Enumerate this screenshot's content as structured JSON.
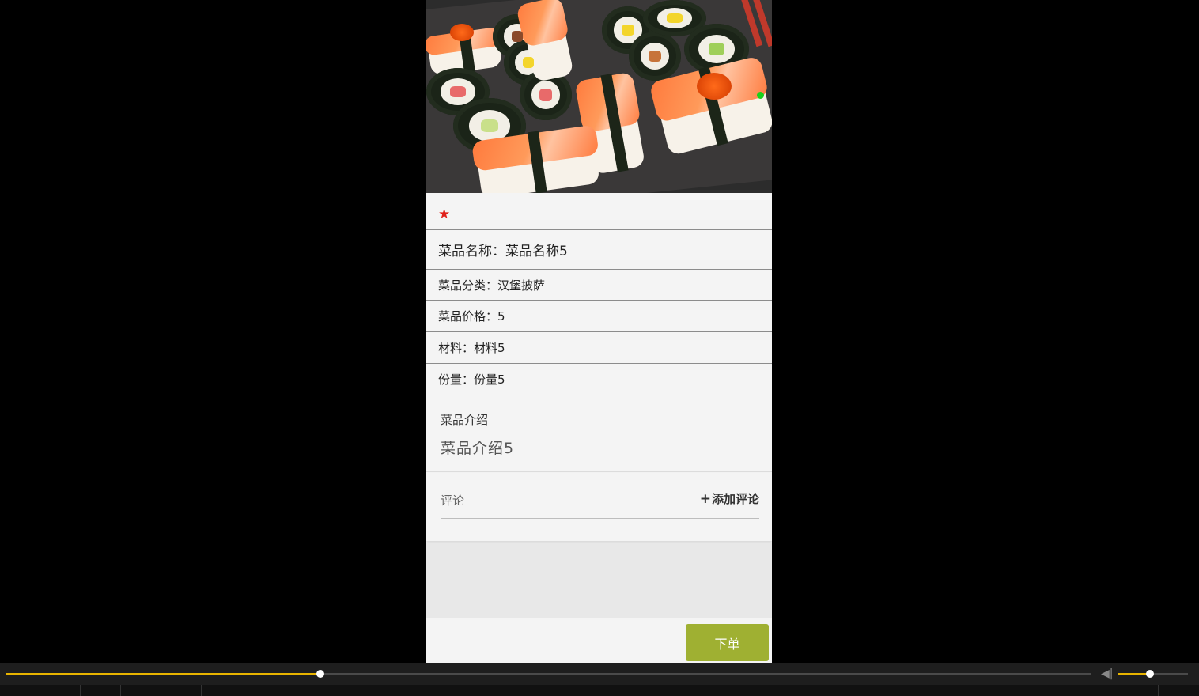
{
  "dish": {
    "favorite_icon": "star-icon",
    "name_label": "菜品名称：",
    "name_value": "菜品名称5",
    "category_label": "菜品分类：",
    "category_value": "汉堡披萨",
    "price_label": "菜品价格：",
    "price_value": "5",
    "material_label": "材料：",
    "material_value": "材料5",
    "portion_label": "份量：",
    "portion_value": "份量5",
    "intro_title": "菜品介绍",
    "intro_body": "菜品介绍5"
  },
  "comments": {
    "label": "评论",
    "add_label": "添加评论"
  },
  "order": {
    "button_label": "下单"
  },
  "player": {
    "progress": 0.29,
    "volume": 0.45,
    "accent_color": "#e8b400"
  },
  "colors": {
    "favorite": "#e0201b",
    "order_button": "#9fb032"
  }
}
